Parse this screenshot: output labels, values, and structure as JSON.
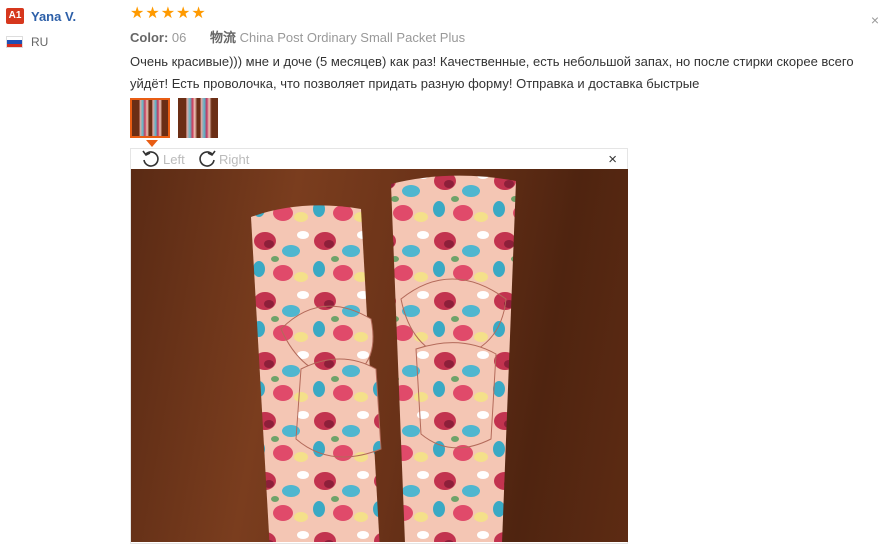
{
  "user": {
    "badge": "A1",
    "name": "Yana V.",
    "country": "RU"
  },
  "review": {
    "rating": 5,
    "stars": [
      "★",
      "★",
      "★",
      "★",
      "★"
    ],
    "color_label": "Color:",
    "color_value": "06",
    "shipping_label": "物流",
    "shipping_value": "China Post Ordinary Small Packet Plus",
    "text": "Очень красивые))) мне и доче (5 месяцев) как раз! Качественные, есть небольшой запах, но после стирки скорее всего уйдёт! Есть проволочка, что позволяет придать разную форму! Отправка и доставка быстрые",
    "close_glyph": "×"
  },
  "viewer": {
    "rotate_left": "Left",
    "rotate_right": "Right",
    "close_glyph": "×"
  },
  "colors": {
    "accent": "#e85d14",
    "star": "#ff9a00",
    "link": "#2c5fa8",
    "badge": "#d6371d"
  },
  "icons": {
    "rotate_left": "rotate-left-icon",
    "rotate_right": "rotate-right-icon"
  }
}
